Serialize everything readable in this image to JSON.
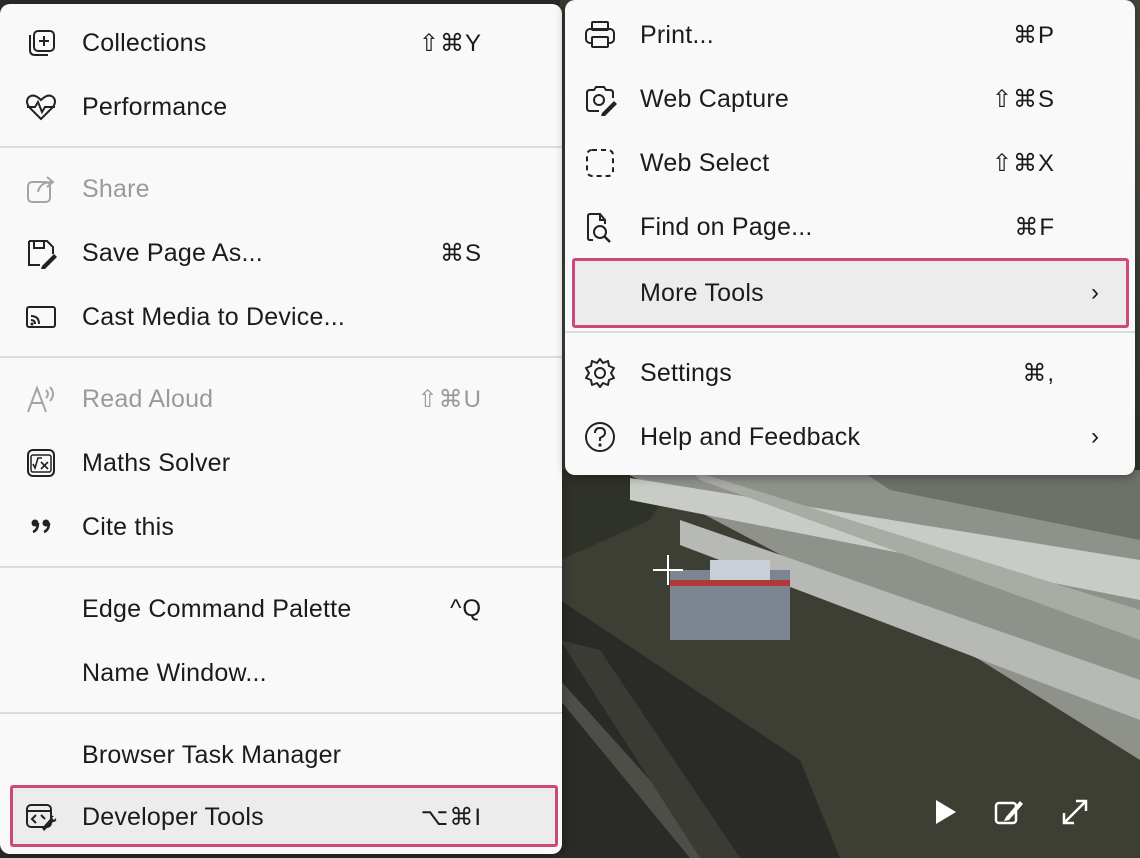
{
  "left_menu": {
    "items": [
      {
        "label": "Collections",
        "shortcut": "⇧⌘Y",
        "icon": "collections-icon"
      },
      {
        "label": "Performance",
        "shortcut": "",
        "icon": "heart-pulse-icon"
      },
      {
        "label": "Share",
        "shortcut": "",
        "icon": "share-icon",
        "disabled": true
      },
      {
        "label": "Save Page As...",
        "shortcut": "⌘S",
        "icon": "save-page-icon"
      },
      {
        "label": "Cast Media to Device...",
        "shortcut": "",
        "icon": "cast-icon"
      },
      {
        "label": "Read Aloud",
        "shortcut": "⇧⌘U",
        "icon": "read-aloud-icon",
        "disabled": true
      },
      {
        "label": "Maths Solver",
        "shortcut": "",
        "icon": "maths-solver-icon"
      },
      {
        "label": "Cite this",
        "shortcut": "",
        "icon": "quote-icon"
      },
      {
        "label": "Edge Command Palette",
        "shortcut": "^Q",
        "icon": ""
      },
      {
        "label": "Name Window...",
        "shortcut": "",
        "icon": ""
      },
      {
        "label": "Browser Task Manager",
        "shortcut": "",
        "icon": ""
      },
      {
        "label": "Developer Tools",
        "shortcut": "⌥⌘I",
        "icon": "developer-tools-icon",
        "highlighted": true
      }
    ]
  },
  "right_menu": {
    "items": [
      {
        "label": "Print...",
        "shortcut": "⌘P",
        "icon": "print-icon"
      },
      {
        "label": "Web Capture",
        "shortcut": "⇧⌘S",
        "icon": "web-capture-icon"
      },
      {
        "label": "Web Select",
        "shortcut": "⇧⌘X",
        "icon": "web-select-icon"
      },
      {
        "label": "Find on Page...",
        "shortcut": "⌘F",
        "icon": "find-on-page-icon"
      },
      {
        "label": "More Tools",
        "shortcut": "",
        "icon": "",
        "submenu": true,
        "highlighted": true
      },
      {
        "label": "Settings",
        "shortcut": "⌘,",
        "icon": "settings-icon"
      },
      {
        "label": "Help and Feedback",
        "shortcut": "",
        "icon": "help-icon",
        "submenu": true
      }
    ]
  },
  "submenu_glyph": "›",
  "colors": {
    "highlight_border": "#d0477a",
    "menu_bg": "#f9f9f9",
    "disabled_text": "#9a9a9a"
  }
}
